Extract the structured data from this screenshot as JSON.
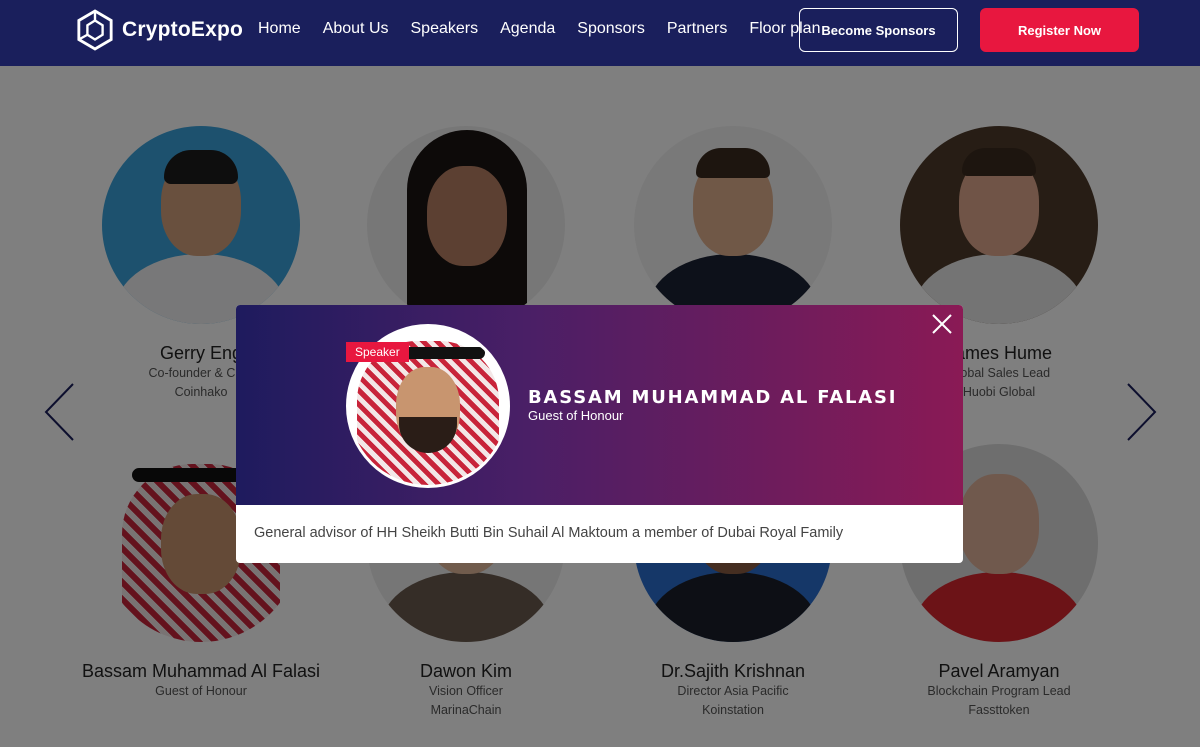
{
  "brand": {
    "name": "CryptoExpo"
  },
  "nav": {
    "items": [
      "Home",
      "About Us",
      "Speakers",
      "Agenda",
      "Sponsors",
      "Partners",
      "Floor plan"
    ],
    "become_sponsors": "Become Sponsors",
    "register": "Register Now"
  },
  "speakers": [
    {
      "name": "Gerry Eng",
      "role": "Co-founder & CEO",
      "org": "Coinhako"
    },
    {
      "name": "",
      "role": "",
      "org": ""
    },
    {
      "name": "",
      "role": "",
      "org": ""
    },
    {
      "name": "James Hume",
      "role": "Global Sales Lead",
      "org": "Huobi Global"
    },
    {
      "name": "Bassam Muhammad Al Falasi",
      "role": "Guest of Honour",
      "org": ""
    },
    {
      "name": "Dawon Kim",
      "role": "Vision Officer",
      "org": "MarinaChain"
    },
    {
      "name": "Dr.Sajith Krishnan",
      "role": "Director Asia Pacific",
      "org": "Koinstation"
    },
    {
      "name": "Pavel Aramyan",
      "role": "Blockchain Program Lead",
      "org": "Fassttoken"
    }
  ],
  "modal": {
    "badge": "Speaker",
    "name": "BASSAM MUHAMMAD AL FALASI",
    "title": "Guest of Honour",
    "bio": "General advisor of HH Sheikh Butti Bin Suhail Al Maktoum a member of Dubai Royal Family"
  },
  "colors": {
    "nav_bg": "#1a1f5c",
    "accent": "#e8173f",
    "modal_gradient_start": "#1e1b5e",
    "modal_gradient_end": "#8a1a55"
  },
  "icons": {
    "close": "close-icon",
    "prev": "chevron-left-icon",
    "next": "chevron-right-icon"
  }
}
